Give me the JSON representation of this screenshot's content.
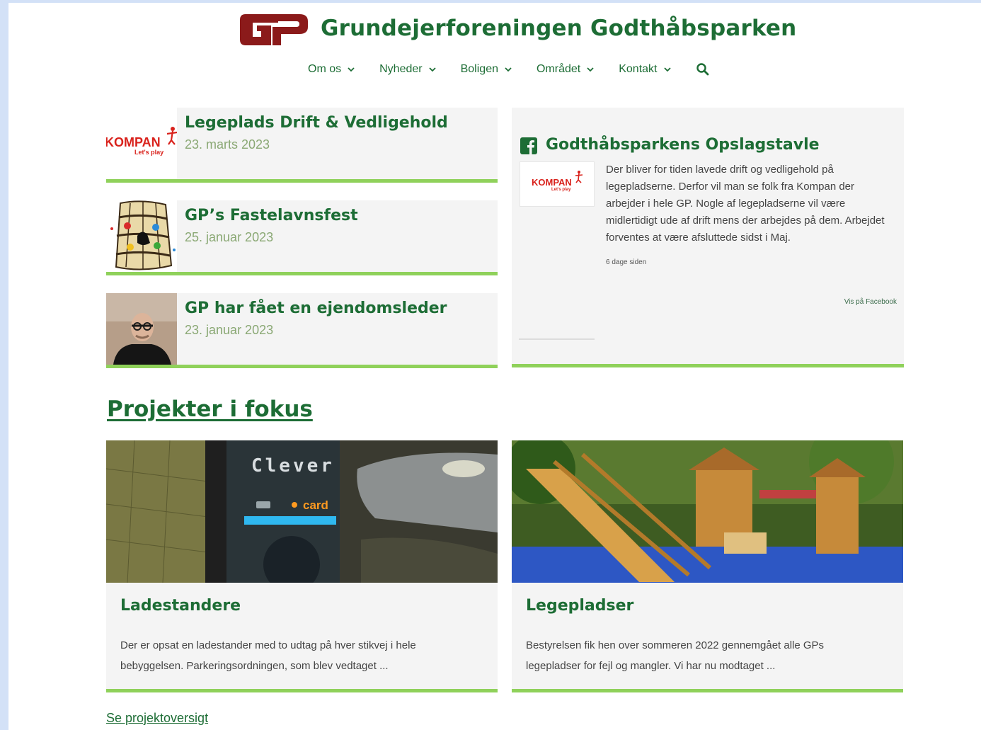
{
  "site": {
    "title": "Grundejerforeningen Godthåbsparken",
    "brand_color": "#1d6d35",
    "logo_color": "#8b1a1a",
    "accent_color": "#8fd15a"
  },
  "nav": {
    "items": [
      {
        "label": "Om os"
      },
      {
        "label": "Nyheder"
      },
      {
        "label": "Boligen"
      },
      {
        "label": "Området"
      },
      {
        "label": "Kontakt"
      }
    ],
    "search_icon": "search-icon"
  },
  "news": [
    {
      "title": "Legeplads Drift & Vedligehold",
      "date": "23. marts 2023",
      "thumb": "kompan-logo"
    },
    {
      "title": "GP’s Fastelavnsfest",
      "date": "25. januar 2023",
      "thumb": "fastelavn-barrel"
    },
    {
      "title": "GP har fået en ejendomsleder",
      "date": "23. januar 2023",
      "thumb": "person-photo"
    }
  ],
  "facebook": {
    "title": "Godthåbsparkens Opslagstavle",
    "icon": "facebook-icon",
    "post_text": "Der bliver for tiden lavede drift og vedligehold på legepladserne. Derfor vil man se folk fra Kompan der arbejder i hele GP. Nogle af legepladserne vil være midlertidigt ude af drift mens der arbejdes på dem. Arbejdet forventes at være afsluttede sidst i Maj.",
    "time": "6 dage siden",
    "link": "Vis på Facebook"
  },
  "logos": {
    "kompan": "KOMPAN",
    "kompan_tagline": "Let's play"
  },
  "projects": {
    "heading": "Projekter i fokus",
    "items": [
      {
        "title": "Ladestandere",
        "excerpt": "Der er opsat en ladestander med to udtag på hver stikvej i hele bebyggelsen. Parkeringsordningen, som blev vedtaget ...",
        "image": "charging-station-photo",
        "image_text": "Clever",
        "image_text2": "card"
      },
      {
        "title": "Legepladser",
        "excerpt": "Bestyrelsen fik hen over sommeren 2022 gennemgået alle GPs legepladser for fejl og mangler. Vi har nu modtaget ...",
        "image": "playground-photo"
      }
    ],
    "overview_link": "Se projektoversigt"
  }
}
